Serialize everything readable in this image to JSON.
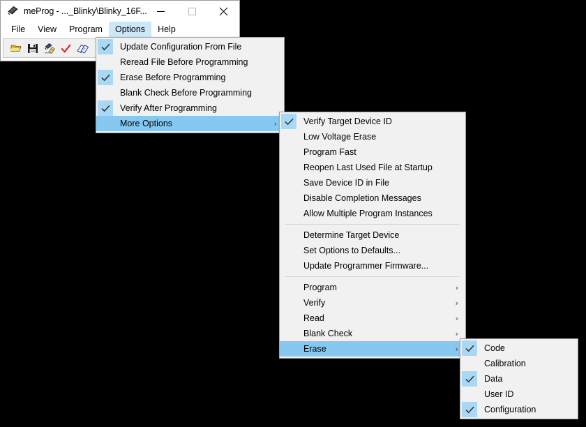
{
  "window": {
    "title": "meProg - ..._Blinky\\Blinky_16F...",
    "icon": "chip-icon",
    "caption": {
      "minimize": "minimize-icon",
      "maximize": "maximize-icon",
      "close": "close-icon"
    }
  },
  "menubar": {
    "items": [
      {
        "label": "File",
        "active": false
      },
      {
        "label": "View",
        "active": false
      },
      {
        "label": "Program",
        "active": false
      },
      {
        "label": "Options",
        "active": true
      },
      {
        "label": "Help",
        "active": false
      }
    ]
  },
  "toolbar": {
    "buttons": [
      {
        "name": "open-file-icon",
        "title": "Open"
      },
      {
        "name": "save-file-icon",
        "title": "Save"
      },
      {
        "name": "program-device-icon",
        "title": "Program"
      },
      {
        "name": "verify-icon",
        "title": "Verify"
      },
      {
        "name": "read-device-icon",
        "title": "Read"
      },
      {
        "name": "bulb-icon",
        "title": "Info"
      }
    ]
  },
  "menu_options": {
    "items": [
      {
        "label": "Update Configuration From File",
        "checked": true,
        "highlight": false,
        "submenu": false
      },
      {
        "label": "Reread File Before Programming",
        "checked": false,
        "highlight": false,
        "submenu": false
      },
      {
        "label": "Erase Before Programming",
        "checked": true,
        "highlight": false,
        "submenu": false
      },
      {
        "label": "Blank Check Before Programming",
        "checked": false,
        "highlight": false,
        "submenu": false
      },
      {
        "label": "Verify After Programming",
        "checked": true,
        "highlight": false,
        "submenu": false
      },
      {
        "label": "More Options",
        "checked": false,
        "highlight": true,
        "submenu": true
      }
    ]
  },
  "menu_more_options": {
    "group1": [
      {
        "label": "Verify Target Device ID",
        "checked": true,
        "highlight": false,
        "submenu": false
      },
      {
        "label": "Low Voltage Erase",
        "checked": false,
        "highlight": false,
        "submenu": false
      },
      {
        "label": "Program Fast",
        "checked": false,
        "highlight": false,
        "submenu": false
      },
      {
        "label": "Reopen Last Used File at Startup",
        "checked": false,
        "highlight": false,
        "submenu": false
      },
      {
        "label": "Save Device ID in File",
        "checked": false,
        "highlight": false,
        "submenu": false
      },
      {
        "label": "Disable Completion Messages",
        "checked": false,
        "highlight": false,
        "submenu": false
      },
      {
        "label": "Allow Multiple Program Instances",
        "checked": false,
        "highlight": false,
        "submenu": false
      }
    ],
    "group2": [
      {
        "label": "Determine Target Device",
        "checked": false,
        "highlight": false,
        "submenu": false
      },
      {
        "label": "Set Options to Defaults...",
        "checked": false,
        "highlight": false,
        "submenu": false
      },
      {
        "label": "Update Programmer Firmware...",
        "checked": false,
        "highlight": false,
        "submenu": false
      }
    ],
    "group3": [
      {
        "label": "Program",
        "checked": false,
        "highlight": false,
        "submenu": true
      },
      {
        "label": "Verify",
        "checked": false,
        "highlight": false,
        "submenu": true
      },
      {
        "label": "Read",
        "checked": false,
        "highlight": false,
        "submenu": true
      },
      {
        "label": "Blank Check",
        "checked": false,
        "highlight": false,
        "submenu": true
      },
      {
        "label": "Erase",
        "checked": false,
        "highlight": true,
        "submenu": true
      }
    ]
  },
  "menu_erase": {
    "items": [
      {
        "label": "Code",
        "checked": true,
        "highlight": false,
        "submenu": false
      },
      {
        "label": "Calibration",
        "checked": false,
        "highlight": false,
        "submenu": false
      },
      {
        "label": "Data",
        "checked": true,
        "highlight": false,
        "submenu": false
      },
      {
        "label": "User ID",
        "checked": false,
        "highlight": false,
        "submenu": false
      },
      {
        "label": "Configuration",
        "checked": true,
        "highlight": false,
        "submenu": false
      }
    ]
  },
  "colors": {
    "highlight_blue": "#86c8f0",
    "check_blue": "#a8d8f5",
    "menubar_active": "#cce8f7",
    "menu_bg": "#f1f1f1",
    "window_bg": "#ffffff",
    "desktop": "#000000"
  },
  "glyphs": {
    "submenu_arrow": "›",
    "checkmark": "check-icon"
  }
}
